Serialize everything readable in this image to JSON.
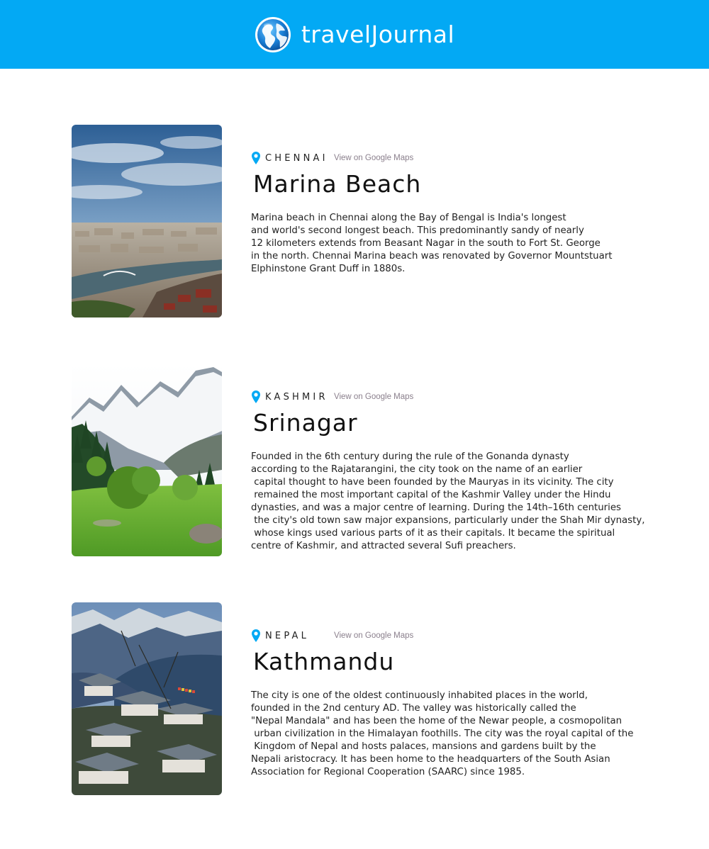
{
  "header": {
    "brand": "travelJournal",
    "logo_icon": "globe-icon",
    "background_color": "#03a9f4"
  },
  "entries": [
    {
      "location": "CHENNAI",
      "maps_link": "View on Google Maps",
      "title": "Marina Beach",
      "description": "Marina beach in Chennai along the Bay of Bengal is India's longest\nand world's second longest beach. This predominantly sandy of nearly\n12 kilometers extends from Beasant Nagar in the south to Fort St. George\nin the north. Chennai Marina beach was renovated by Governor Mountstuart\nElphinstone Grant Duff in 1880s.",
      "image": "city-river-aerial-photo"
    },
    {
      "location": "KASHMIR",
      "maps_link": "View on Google Maps",
      "title": "Srinagar",
      "description": "Founded in the 6th century during the rule of the Gonanda dynasty\naccording to the Rajatarangini, the city took on the name of an earlier\n capital thought to have been founded by the Mauryas in its vicinity. The city\n remained the most important capital of the Kashmir Valley under the Hindu\ndynasties, and was a major centre of learning. During the 14th–16th centuries\n the city's old town saw major expansions, particularly under the Shah Mir dynasty,\n whose kings used various parts of it as their capitals. It became the spiritual\ncentre of Kashmir, and attracted several Sufi preachers.",
      "image": "snowy-mountain-valley-photo"
    },
    {
      "location": "NEPAL",
      "maps_link": "View on Google Maps",
      "title": "Kathmandu",
      "description": "The city is one of the oldest continuously inhabited places in the world,\nfounded in the 2nd century AD. The valley was historically called the\n\"Nepal Mandala\" and has been the home of the Newar people, a cosmopolitan\n urban civilization in the Himalayan foothills. The city was the royal capital of the\n Kingdom of Nepal and hosts palaces, mansions and gardens built by the\nNepali aristocracy. It has been home to the headquarters of the South Asian\nAssociation for Regional Cooperation (SAARC) since 1985.",
      "image": "mountain-village-photo"
    }
  ],
  "colors": {
    "accent": "#03a9f4",
    "link": "#8a7f8c",
    "text": "#111111"
  }
}
